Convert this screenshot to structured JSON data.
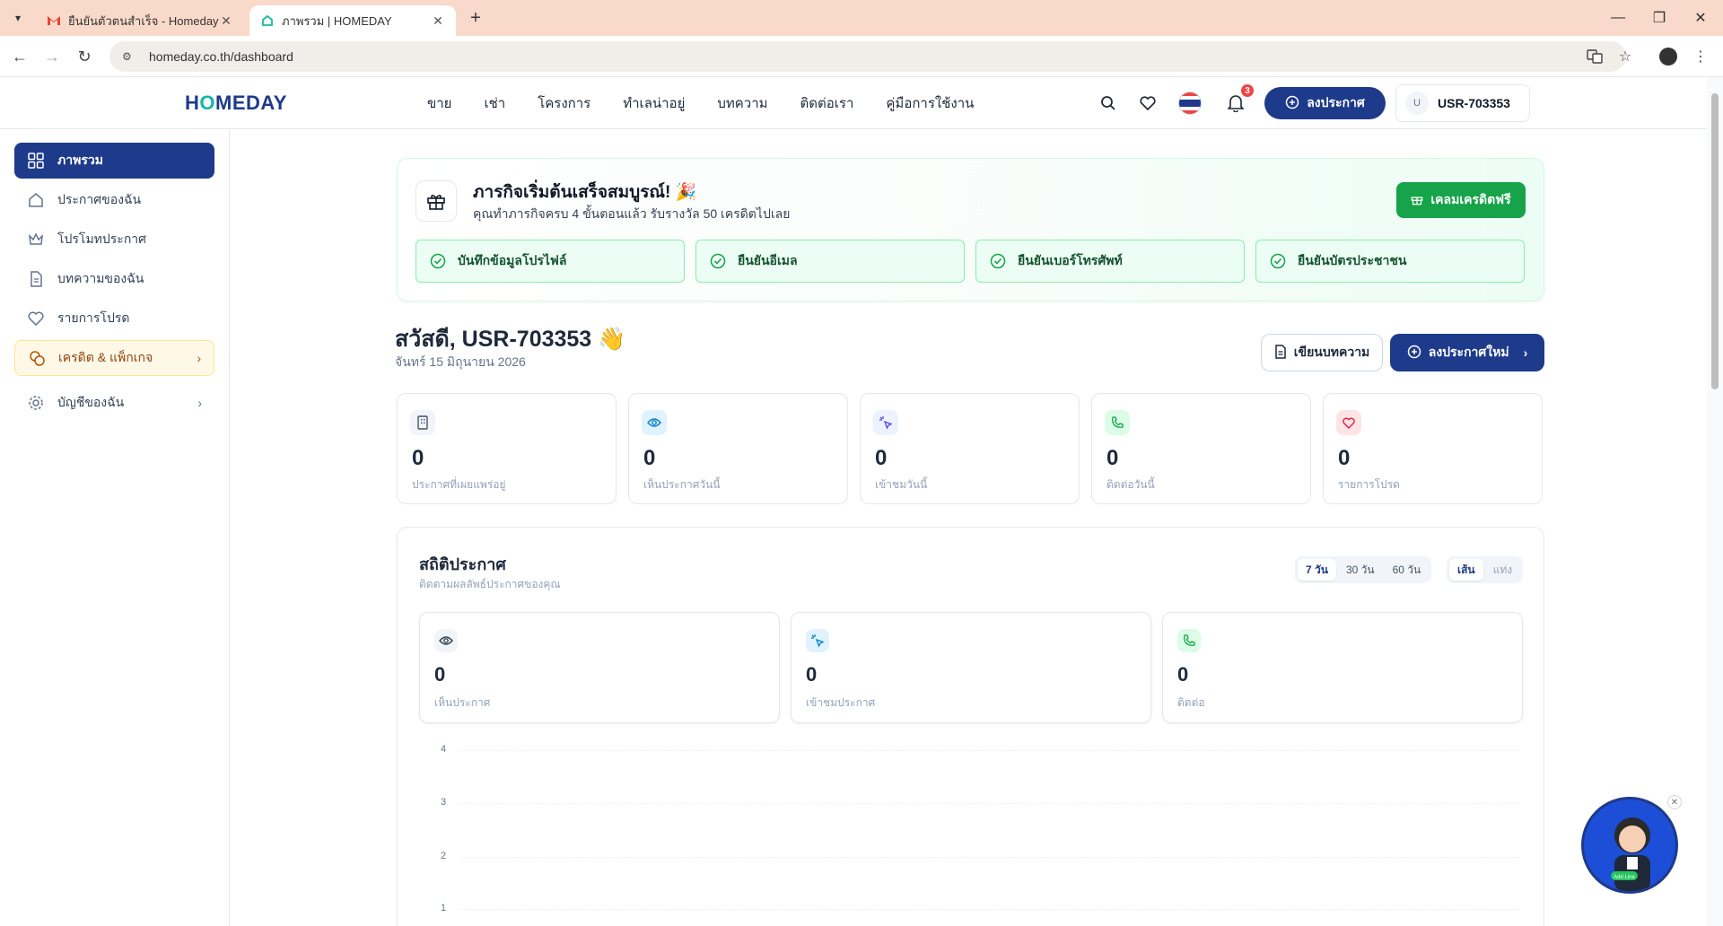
{
  "browser": {
    "tabs": [
      {
        "title": "ยืนยันตัวตนสำเร็จ - Homeday - ก...",
        "icon": "gmail-icon"
      },
      {
        "title": "ภาพรวม | HOMEDAY",
        "icon": "homeday-icon"
      }
    ],
    "url": "homeday.co.th/dashboard"
  },
  "header": {
    "logo": "HOMEDAY",
    "nav": [
      "ขาย",
      "เช่า",
      "โครงการ",
      "ทำเลน่าอยู่",
      "บทความ",
      "ติดต่อเรา",
      "คู่มือการใช้งาน"
    ],
    "notifications_count": "3",
    "post_button": "ลงประกาศ",
    "user_initial": "U",
    "username": "USR-703353"
  },
  "sidebar": {
    "items": [
      {
        "label": "ภาพรวม",
        "icon": "grid-icon"
      },
      {
        "label": "ประกาศของฉัน",
        "icon": "home-icon"
      },
      {
        "label": "โปรโมทประกาศ",
        "icon": "crown-icon"
      },
      {
        "label": "บทความของฉัน",
        "icon": "document-icon"
      },
      {
        "label": "รายการโปรด",
        "icon": "heart-icon"
      },
      {
        "label": "เครดิต & แพ็กเกจ",
        "icon": "coins-icon"
      },
      {
        "label": "บัญชีของฉัน",
        "icon": "gear-icon"
      }
    ]
  },
  "mission": {
    "title": "ภารกิจเริ่มต้นเสร็จสมบูรณ์! 🎉",
    "subtitle": "คุณทำภารกิจครบ 4 ขั้นตอนแล้ว รับรางวัล 50 เครดิตไปเลย",
    "claim_button": "เคลมเครดิตฟรี",
    "steps": [
      "บันทึกข้อมูลโปรไฟล์",
      "ยืนยันอีเมล",
      "ยืนยันเบอร์โทรศัพท์",
      "ยืนยันบัตรประชาชน"
    ]
  },
  "greeting": {
    "text": "สวัสดี, USR-703353 👋",
    "date": "จันทร์ 15 มิถุนายน 2026",
    "write_button": "เขียนบทความ",
    "new_post_button": "ลงประกาศใหม่"
  },
  "summary": [
    {
      "value": "0",
      "label": "ประกาศที่เผยแพร่อยู่",
      "icon": "building-icon",
      "color": "#475569"
    },
    {
      "value": "0",
      "label": "เห็นประกาศวันนี้",
      "icon": "eye-icon",
      "color": "#0284c7"
    },
    {
      "value": "0",
      "label": "เข้าชมวันนี้",
      "icon": "click-icon",
      "color": "#4f46e5"
    },
    {
      "value": "0",
      "label": "ติดต่อวันนี้",
      "icon": "phone-icon",
      "color": "#16a34a"
    },
    {
      "value": "0",
      "label": "รายการโปรด",
      "icon": "heart-icon",
      "color": "#e11d48"
    }
  ],
  "stats": {
    "title": "สถิติประกาศ",
    "subtitle": "ติดตามผลลัพธ์ประกาศของคุณ",
    "ranges": [
      "7 วัน",
      "30 วัน",
      "60 วัน"
    ],
    "selected_range": "7 วัน",
    "chart_types": [
      "เส้น",
      "แท่ง"
    ],
    "selected_chart_type": "เส้น",
    "metrics": [
      {
        "value": "0",
        "label": "เห็นประกาศ",
        "icon": "eye-icon"
      },
      {
        "value": "0",
        "label": "เข้าชมประกาศ",
        "icon": "click-icon"
      },
      {
        "value": "0",
        "label": "ติดต่อ",
        "icon": "phone-icon"
      }
    ],
    "y_ticks": [
      "4",
      "3",
      "2",
      "1"
    ]
  },
  "widget": {
    "line_label": "Add Line"
  }
}
